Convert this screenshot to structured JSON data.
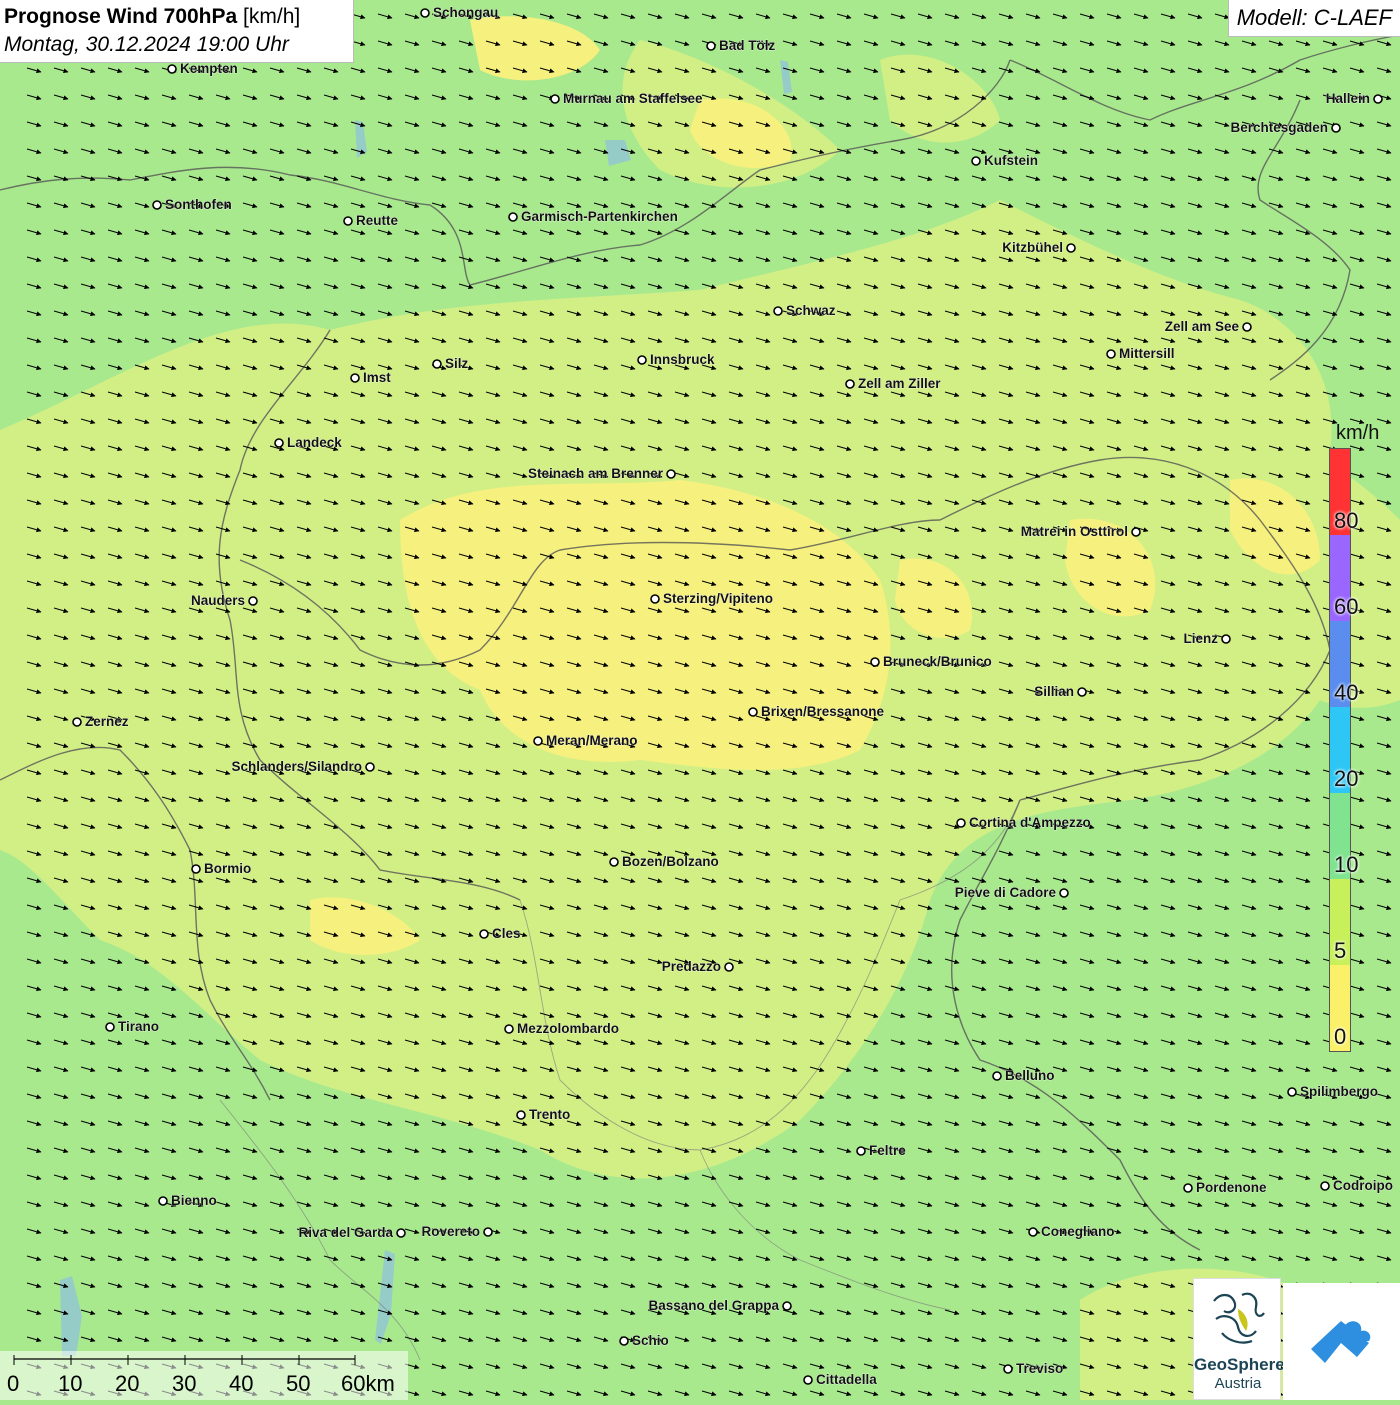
{
  "title": {
    "main": "Prognose Wind 700hPa",
    "unit": "[km/h]",
    "datetime": "Montag, 30.12.2024 19:00 Uhr"
  },
  "model": "Modell: C-LAEF",
  "legend": {
    "unit": "km/h",
    "ticks": [
      "80",
      "60",
      "40",
      "20",
      "10",
      "5",
      "0"
    ],
    "colors": [
      "#ff3333",
      "#9966ff",
      "#5b8def",
      "#2ec6f5",
      "#7fe38f",
      "#c8f05a",
      "#fbf06a"
    ]
  },
  "scalebar": {
    "ticks": [
      "0",
      "10",
      "20",
      "30",
      "40",
      "50",
      "60km"
    ]
  },
  "logos": {
    "geosphere_line1": "GeoSphere",
    "geosphere_line2": "Austria"
  },
  "wind_arrows": {
    "direction": "east-south-east",
    "color": "#000000"
  },
  "cities": [
    {
      "name": "Schongau"
    },
    {
      "name": "Kempten"
    },
    {
      "name": "Bad Tölz"
    },
    {
      "name": "Murnau am Staffelsee"
    },
    {
      "name": "Hallein"
    },
    {
      "name": "Berchtesgaden"
    },
    {
      "name": "Kufstein"
    },
    {
      "name": "Sonthofen"
    },
    {
      "name": "Reutte"
    },
    {
      "name": "Garmisch-Partenkirchen"
    },
    {
      "name": "Kitzbühel"
    },
    {
      "name": "Schwaz"
    },
    {
      "name": "Zell am See"
    },
    {
      "name": "Mittersill"
    },
    {
      "name": "Innsbruck"
    },
    {
      "name": "Silz"
    },
    {
      "name": "Imst"
    },
    {
      "name": "Zell am Ziller"
    },
    {
      "name": "Landeck"
    },
    {
      "name": "Steinach am Brenner"
    },
    {
      "name": "Matrei in Osttirol"
    },
    {
      "name": "Nauders"
    },
    {
      "name": "Sterzing/Vipiteno"
    },
    {
      "name": "Lienz"
    },
    {
      "name": "Bruneck/Brunico"
    },
    {
      "name": "Sillian"
    },
    {
      "name": "Brixen/Bressanone"
    },
    {
      "name": "Zernez"
    },
    {
      "name": "Meran/Merano"
    },
    {
      "name": "Schlanders/Silandro"
    },
    {
      "name": "Cortina d'Ampezzo"
    },
    {
      "name": "Bozen/Bolzano"
    },
    {
      "name": "Bormio"
    },
    {
      "name": "Pieve di Cadore"
    },
    {
      "name": "Cles"
    },
    {
      "name": "Predazzo"
    },
    {
      "name": "Tirano"
    },
    {
      "name": "Mezzolombardo"
    },
    {
      "name": "Belluno"
    },
    {
      "name": "Spilimbergo"
    },
    {
      "name": "Trento"
    },
    {
      "name": "Feltre"
    },
    {
      "name": "Pordenone"
    },
    {
      "name": "Codroipo"
    },
    {
      "name": "Bienno"
    },
    {
      "name": "Riva del Garda"
    },
    {
      "name": "Rovereto"
    },
    {
      "name": "Conegliano"
    },
    {
      "name": "Bassano del Grappa"
    },
    {
      "name": "Schio"
    },
    {
      "name": "Treviso"
    },
    {
      "name": "Cittadella"
    }
  ]
}
